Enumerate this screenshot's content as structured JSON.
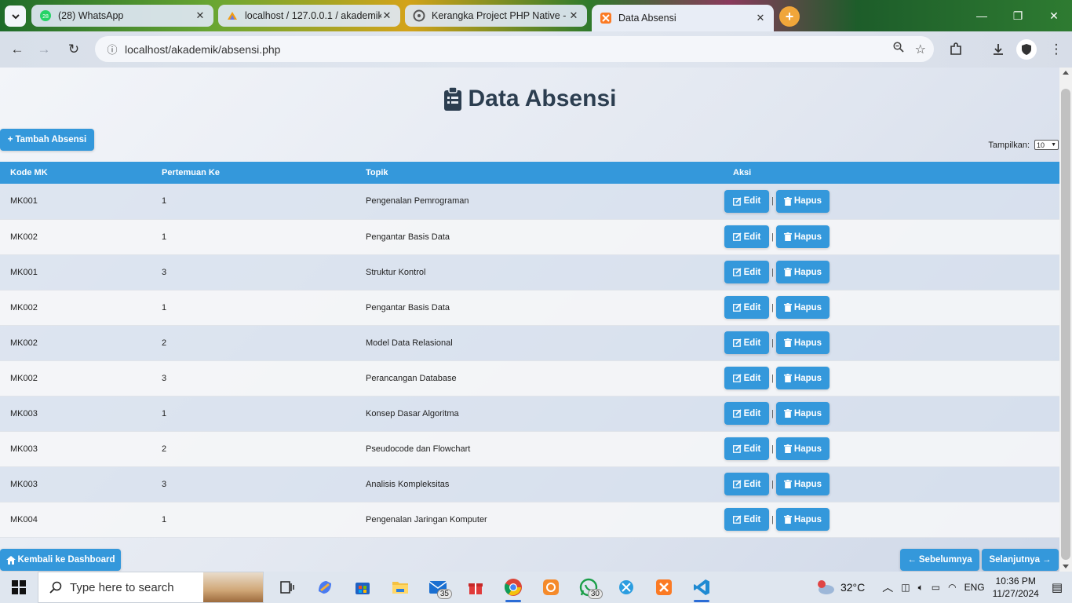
{
  "browser": {
    "tabs": [
      {
        "title": "(28) WhatsApp",
        "favicon": "whatsapp-icon",
        "badge": "28"
      },
      {
        "title": "localhost / 127.0.0.1 / akademik",
        "favicon": "phpmyadmin-icon"
      },
      {
        "title": "Kerangka Project PHP Native -",
        "favicon": "chatgpt-icon"
      },
      {
        "title": "Data Absensi",
        "favicon": "xampp-icon"
      }
    ],
    "url": "localhost/akademik/absensi.php"
  },
  "page": {
    "title": "Data Absensi",
    "add_label": "Tambah Absensi",
    "show_label": "Tampilkan:",
    "show_value": "10",
    "columns": [
      "Kode MK",
      "Pertemuan Ke",
      "Topik",
      "Aksi"
    ],
    "rows": [
      {
        "kode": "MK001",
        "pertemuan": "1",
        "topik": "Pengenalan Pemrograman"
      },
      {
        "kode": "MK002",
        "pertemuan": "1",
        "topik": "Pengantar Basis Data"
      },
      {
        "kode": "MK001",
        "pertemuan": "3",
        "topik": "Struktur Kontrol"
      },
      {
        "kode": "MK002",
        "pertemuan": "1",
        "topik": "Pengantar Basis Data"
      },
      {
        "kode": "MK002",
        "pertemuan": "2",
        "topik": "Model Data Relasional"
      },
      {
        "kode": "MK002",
        "pertemuan": "3",
        "topik": "Perancangan Database"
      },
      {
        "kode": "MK003",
        "pertemuan": "1",
        "topik": "Konsep Dasar Algoritma"
      },
      {
        "kode": "MK003",
        "pertemuan": "2",
        "topik": "Pseudocode dan Flowchart"
      },
      {
        "kode": "MK003",
        "pertemuan": "3",
        "topik": "Analisis Kompleksitas"
      },
      {
        "kode": "MK004",
        "pertemuan": "1",
        "topik": "Pengenalan Jaringan Komputer"
      }
    ],
    "edit_label": "Edit",
    "delete_label": "Hapus",
    "separator": "|",
    "back_label": "Kembali ke Dashboard",
    "prev_label": "Sebelumnya",
    "next_label": "Selanjutnya",
    "accent_color": "#3498db"
  },
  "taskbar": {
    "search_placeholder": "Type here to search",
    "mail_badge": "35",
    "whatsapp_badge": "30",
    "weather": "32°C",
    "language": "ENG",
    "time": "10:36 PM",
    "date": "11/27/2024"
  }
}
